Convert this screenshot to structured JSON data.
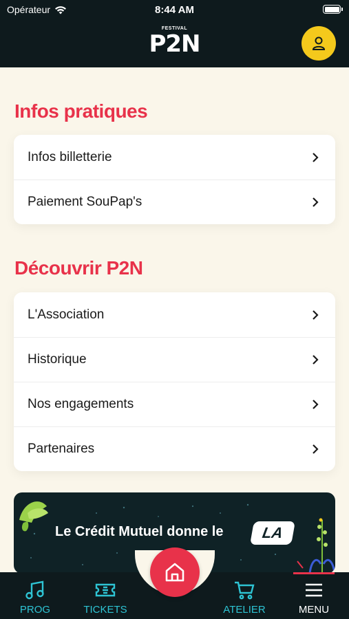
{
  "status_bar": {
    "carrier": "Opérateur",
    "time": "8:44 AM"
  },
  "header": {
    "logo_small": "FESTIVAL",
    "logo_big": "P2N",
    "profile_icon": "user-icon"
  },
  "sections": [
    {
      "title": "Infos pratiques",
      "items": [
        {
          "label": "Infos billetterie"
        },
        {
          "label": "Paiement SouPap's"
        }
      ]
    },
    {
      "title": "Découvrir P2N",
      "items": [
        {
          "label": "L'Association"
        },
        {
          "label": "Historique"
        },
        {
          "label": "Nos engagements"
        },
        {
          "label": "Partenaires"
        }
      ]
    }
  ],
  "banner": {
    "text": "Le Crédit Mutuel donne le",
    "badge": "LA"
  },
  "bottom_nav": {
    "items": [
      {
        "label": "PROG",
        "icon": "music-note-icon",
        "color": "#2ec4d4"
      },
      {
        "label": "TICKETS",
        "icon": "ticket-icon",
        "color": "#2ec4d4"
      },
      {
        "label": "ATELIER",
        "icon": "cart-icon",
        "color": "#2ec4d4"
      },
      {
        "label": "MENU",
        "icon": "hamburger-menu-icon",
        "color": "#ffffff"
      }
    ],
    "home_icon": "home-icon"
  },
  "colors": {
    "accent_red": "#e8324a",
    "accent_yellow": "#f4c91c",
    "accent_teal": "#2ec4d4",
    "dark": "#0e1a1d",
    "background": "#faf6ea"
  }
}
